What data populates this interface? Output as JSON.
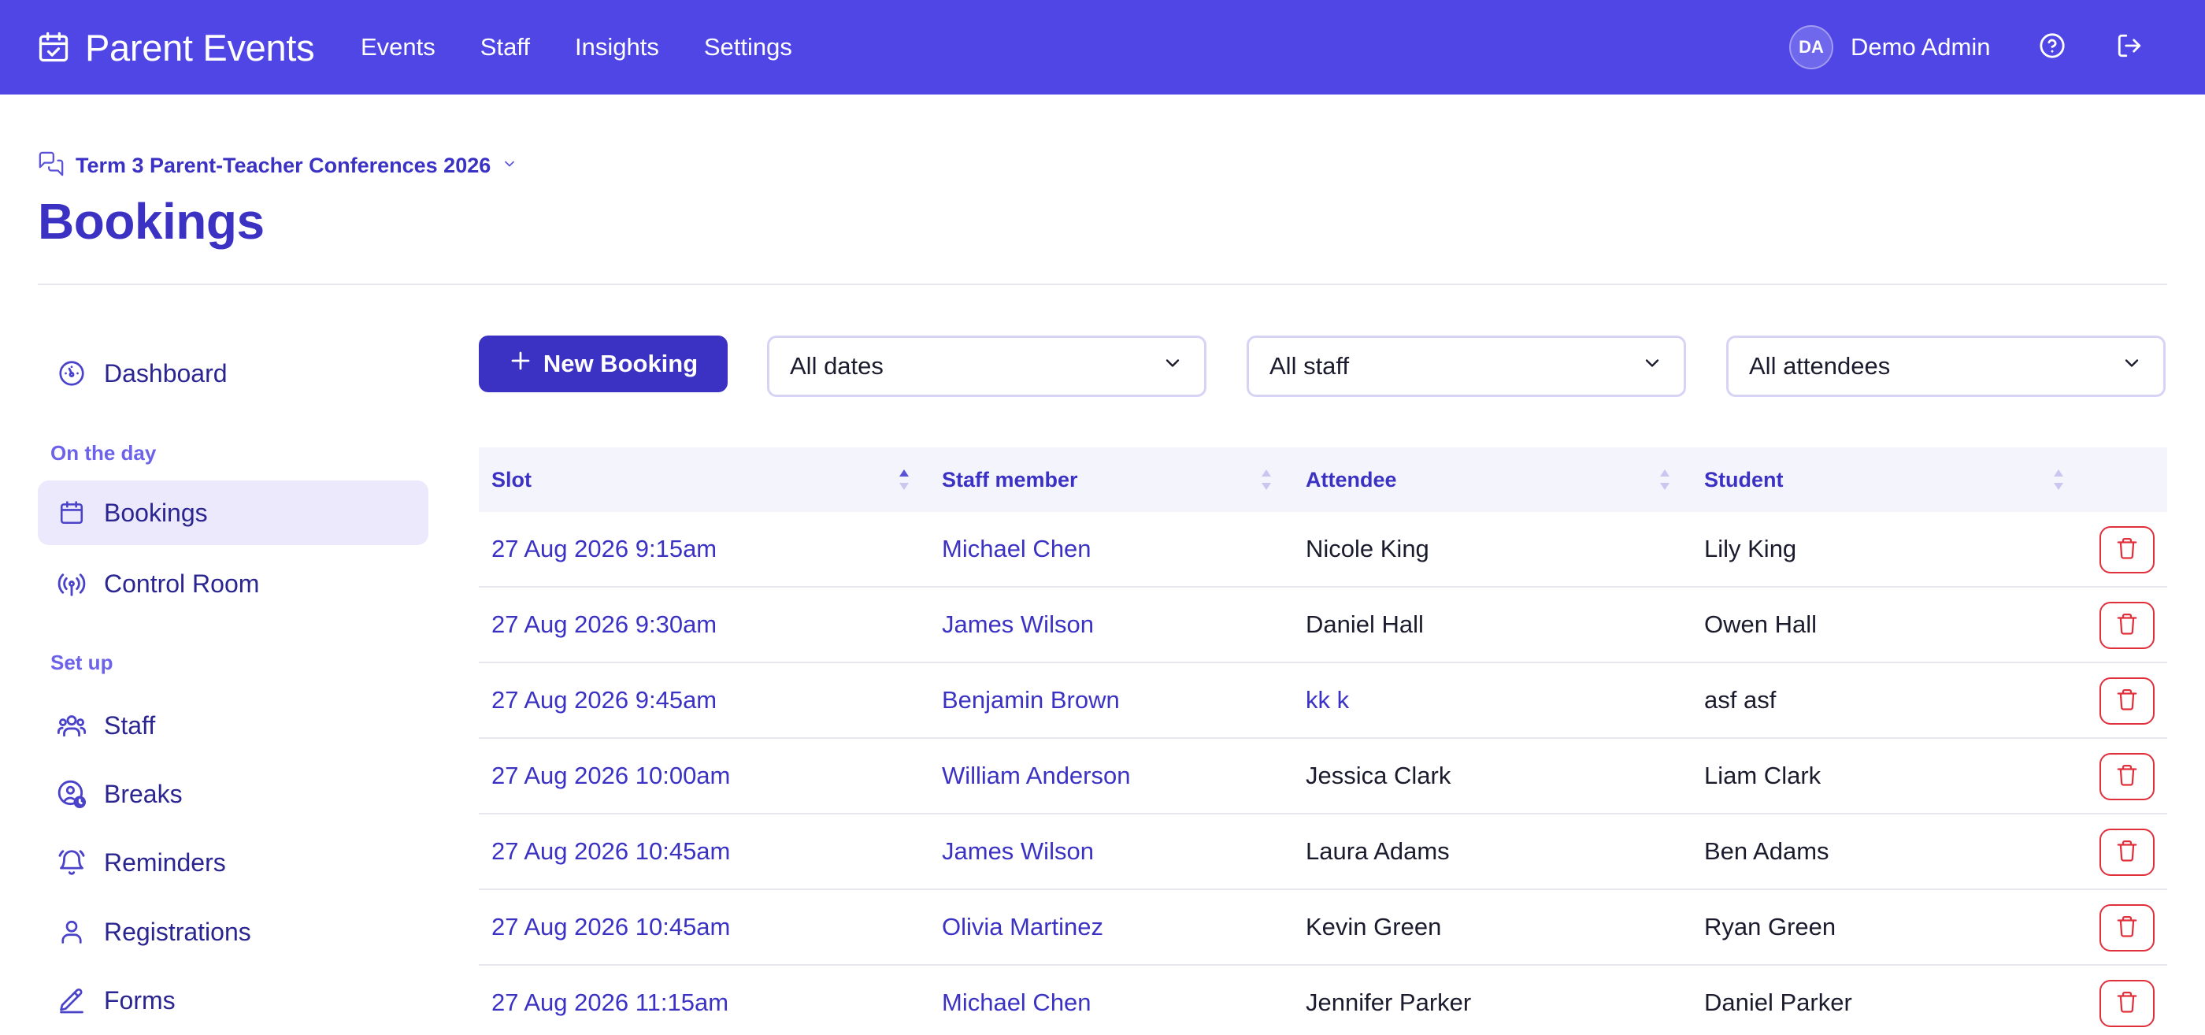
{
  "app": {
    "name": "Parent Events"
  },
  "nav": {
    "items": [
      "Events",
      "Staff",
      "Insights",
      "Settings"
    ]
  },
  "user": {
    "initials": "DA",
    "name": "Demo Admin"
  },
  "event": {
    "name": "Term 3 Parent-Teacher Conferences 2026"
  },
  "page": {
    "title": "Bookings"
  },
  "sidebar": {
    "dashboard": "Dashboard",
    "section_day": "On the day",
    "bookings": "Bookings",
    "control_room": "Control Room",
    "section_setup": "Set up",
    "staff": "Staff",
    "breaks": "Breaks",
    "reminders": "Reminders",
    "registrations": "Registrations",
    "forms": "Forms"
  },
  "toolbar": {
    "new_booking": "New Booking",
    "dates": "All dates",
    "staff": "All staff",
    "attendees": "All attendees"
  },
  "table": {
    "headers": {
      "slot": "Slot",
      "staff": "Staff member",
      "attendee": "Attendee",
      "student": "Student"
    },
    "rows": [
      {
        "slot": "27 Aug 2026 9:15am",
        "staff": "Michael Chen",
        "attendee": "Nicole King",
        "student": "Lily King"
      },
      {
        "slot": "27 Aug 2026 9:30am",
        "staff": "James Wilson",
        "attendee": "Daniel Hall",
        "student": "Owen Hall"
      },
      {
        "slot": "27 Aug 2026 9:45am",
        "staff": "Benjamin Brown",
        "attendee": "kk k",
        "student": "asf asf"
      },
      {
        "slot": "27 Aug 2026 10:00am",
        "staff": "William Anderson",
        "attendee": "Jessica Clark",
        "student": "Liam Clark"
      },
      {
        "slot": "27 Aug 2026 10:45am",
        "staff": "James Wilson",
        "attendee": "Laura Adams",
        "student": "Ben Adams"
      },
      {
        "slot": "27 Aug 2026 10:45am",
        "staff": "Olivia Martinez",
        "attendee": "Kevin Green",
        "student": "Ryan Green"
      },
      {
        "slot": "27 Aug 2026 11:15am",
        "staff": "Michael Chen",
        "attendee": "Jennifer Parker",
        "student": "Daniel Parker"
      }
    ]
  },
  "colors": {
    "brand": "#4f46e5",
    "primary": "#3b32c4",
    "danger": "#e0303b",
    "active_bg": "#ebe9fb"
  }
}
